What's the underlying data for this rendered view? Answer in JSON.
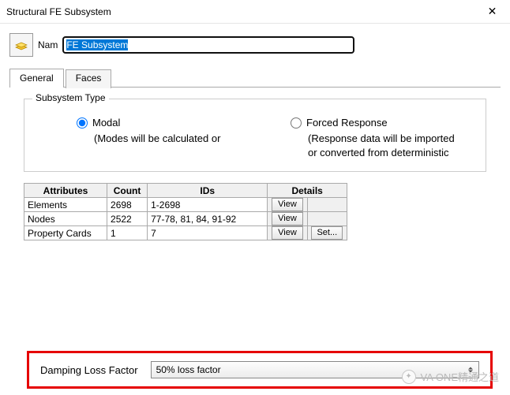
{
  "window": {
    "title": "Structural FE Subsystem"
  },
  "name": {
    "label": "Nam",
    "value": "FE Subsystem"
  },
  "tabs": [
    {
      "label": "General",
      "active": true
    },
    {
      "label": "Faces",
      "active": false
    }
  ],
  "subsystem_type": {
    "legend": "Subsystem Type",
    "options": [
      {
        "label": "Modal",
        "desc": "(Modes will be calculated or",
        "checked": true
      },
      {
        "label": "Forced Response",
        "desc": "(Response data will be imported or converted from deterministic",
        "checked": false
      }
    ]
  },
  "table": {
    "headers": [
      "Attributes",
      "Count",
      "IDs",
      "Details"
    ],
    "rows": [
      {
        "attr": "Elements",
        "count": "2698",
        "ids": "1-2698",
        "actions": [
          "View"
        ]
      },
      {
        "attr": "Nodes",
        "count": "2522",
        "ids": "77-78, 81, 84, 91-92",
        "actions": [
          "View"
        ]
      },
      {
        "attr": "Property Cards",
        "count": "1",
        "ids": "7",
        "actions": [
          "View",
          "Set..."
        ]
      }
    ]
  },
  "dlf": {
    "label": "Damping Loss Factor",
    "value": "50% loss factor"
  },
  "watermark": "VA ONE精通之道"
}
